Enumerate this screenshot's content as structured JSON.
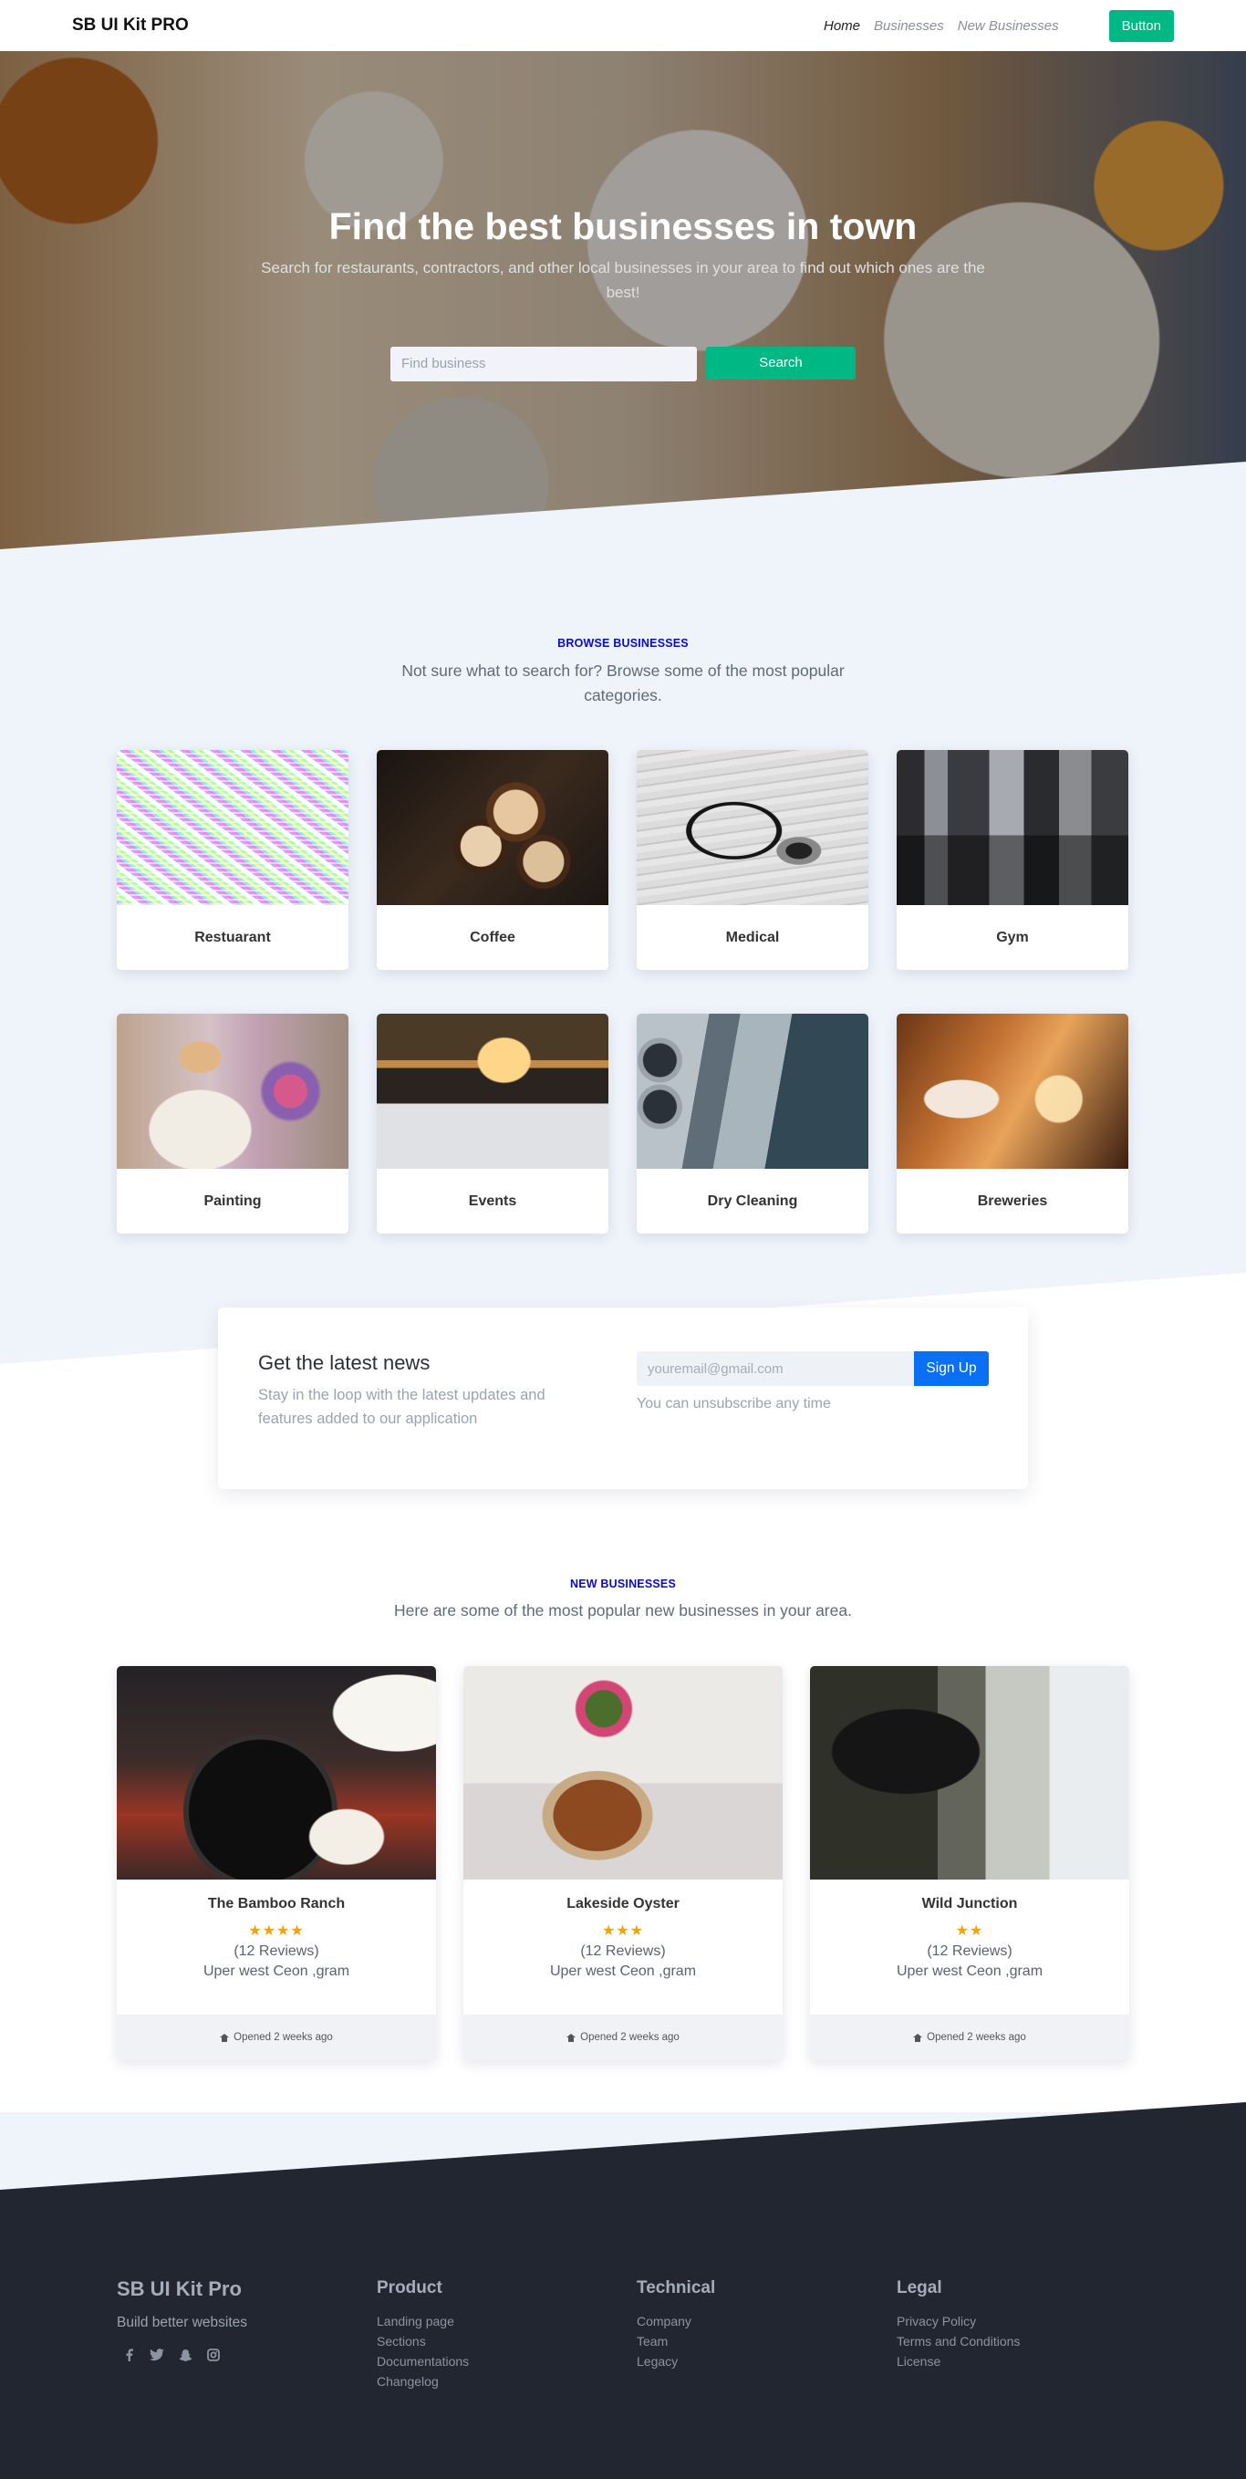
{
  "nav": {
    "brand": "SB UI Kit PRO",
    "links": [
      "Home",
      "Businesses",
      "New Businesses"
    ],
    "button": "Button"
  },
  "hero": {
    "title": "Find the best businesses in town",
    "subtitle": "Search for restaurants, contractors, and other local businesses in your area to find out which ones are the best!",
    "search_placeholder": "Find business",
    "search_button": "Search"
  },
  "browse": {
    "eyebrow": "BROWSE BUSINESSES",
    "lead": "Not sure what to search for? Browse some of the most popular categories.",
    "categories": [
      {
        "label": "Restuarant",
        "icon": "restaurant-photo"
      },
      {
        "label": "Coffee",
        "icon": "coffee-photo"
      },
      {
        "label": "Medical",
        "icon": "stethoscope-photo"
      },
      {
        "label": "Gym",
        "icon": "gym-photo"
      },
      {
        "label": "Painting",
        "icon": "painting-photo"
      },
      {
        "label": "Events",
        "icon": "events-photo"
      },
      {
        "label": "Dry Cleaning",
        "icon": "laundry-photo"
      },
      {
        "label": "Breweries",
        "icon": "brewery-photo"
      }
    ]
  },
  "newsletter": {
    "title": "Get the latest news",
    "text": "Stay in the loop with the latest updates and features added to our application",
    "email_placeholder": "youremail@gmail.com",
    "button": "Sign Up",
    "note": "You can unsubscribe any time"
  },
  "new_businesses": {
    "eyebrow": "NEW BUSINESSES",
    "lead": "Here are some of the most popular new businesses in your area.",
    "items": [
      {
        "name": "The Bamboo Ranch",
        "stars": "★★★★",
        "rating": 4,
        "reviews": "(12 Reviews)",
        "location": "Uper west Ceon ,gram",
        "opened": "Opened 2 weeks ago"
      },
      {
        "name": "Lakeside Oyster",
        "stars": "★★★",
        "rating": 3,
        "reviews": "(12 Reviews)",
        "location": "Uper west Ceon ,gram",
        "opened": "Opened 2 weeks ago"
      },
      {
        "name": "Wild Junction",
        "stars": "★★",
        "rating": 2,
        "reviews": "(12 Reviews)",
        "location": "Uper west Ceon ,gram",
        "opened": "Opened 2 weeks ago"
      }
    ]
  },
  "footer": {
    "brand": "SB UI Kit Pro",
    "tagline": "Build better websites",
    "social": [
      "facebook-icon",
      "twitter-icon",
      "snapchat-icon",
      "instagram-icon"
    ],
    "columns": [
      {
        "heading": "Product",
        "links": [
          "Landing page",
          "Sections",
          "Documentations",
          "Changelog"
        ]
      },
      {
        "heading": "Technical",
        "links": [
          "Company",
          "Team",
          "Legacy"
        ]
      },
      {
        "heading": "Legal",
        "links": [
          "Privacy Policy",
          "Terms and Conditions",
          "License"
        ]
      }
    ]
  },
  "colors": {
    "accent": "#00b884",
    "primary": "#0a6ff2",
    "eyebrow": "#0a0acb",
    "page_bg": "#eff3fa",
    "footer_bg": "#212631",
    "star": "#f2a20c"
  }
}
